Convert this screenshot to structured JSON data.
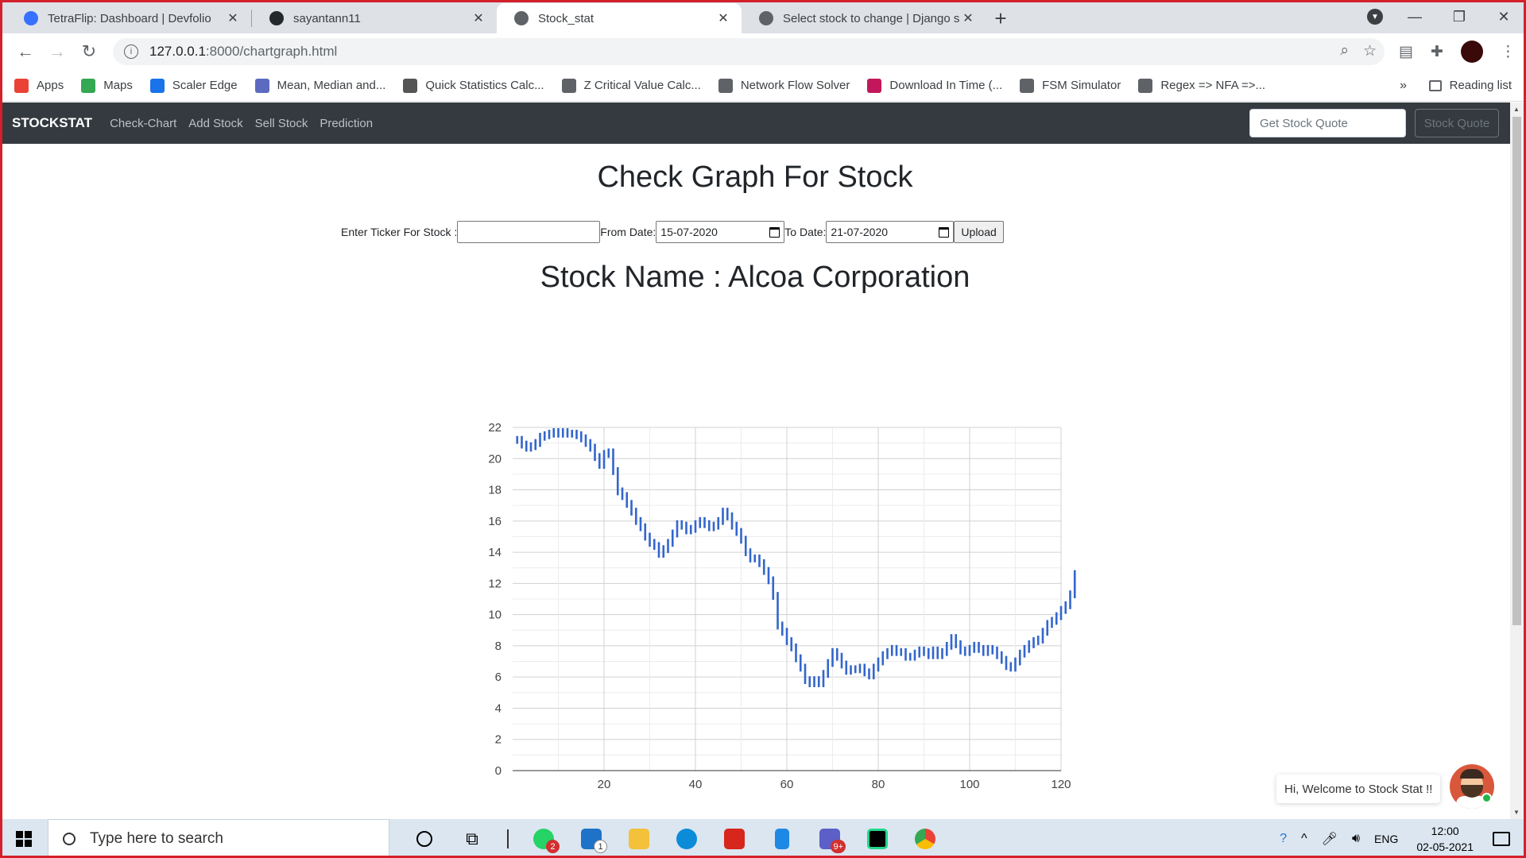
{
  "browser": {
    "tabs": [
      {
        "title": "TetraFlip: Dashboard | Devfolio",
        "favicon_color": "#3770ff",
        "active": false
      },
      {
        "title": "sayantann11",
        "favicon_color": "#24292e",
        "active": false
      },
      {
        "title": "Stock_stat",
        "favicon_color": "#5f6368",
        "active": true
      },
      {
        "title": "Select stock to change | Django s",
        "favicon_color": "#5f6368",
        "active": false
      }
    ],
    "url_host": "127.0.0.1",
    "url_rest": ":8000/chartgraph.html",
    "bookmarks": [
      {
        "label": "Apps",
        "color": "#ea4335"
      },
      {
        "label": "Maps",
        "color": "#34a853"
      },
      {
        "label": "Scaler Edge",
        "color": "#1a73e8"
      },
      {
        "label": "Mean, Median and...",
        "color": "#5c6bc0"
      },
      {
        "label": "Quick Statistics Calc...",
        "color": "#555555"
      },
      {
        "label": "Z Critical Value Calc...",
        "color": "#5f6368"
      },
      {
        "label": "Network Flow Solver",
        "color": "#5f6368"
      },
      {
        "label": "Download In Time (...",
        "color": "#c2185b"
      },
      {
        "label": "FSM Simulator",
        "color": "#5f6368"
      },
      {
        "label": "Regex => NFA =>...",
        "color": "#5f6368"
      }
    ],
    "bookmarks_more": "»",
    "reading_list": "Reading list"
  },
  "app": {
    "brand": "STOCKSTAT",
    "nav": [
      "Check-Chart",
      "Add Stock",
      "Sell Stock",
      "Prediction"
    ],
    "quote_placeholder": "Get Stock Quote",
    "quote_button": "Stock Quote",
    "title": "Check Graph For Stock",
    "form": {
      "ticker_label": "Enter Ticker For Stock :",
      "ticker_value": "",
      "from_label": "From Date:",
      "from_value": "15-07-2020",
      "to_label": "To Date:",
      "to_value": "21-07-2020",
      "upload": "Upload"
    },
    "stock_name": "Stock Name : Alcoa Corporation",
    "chat_text": "Hi, Welcome to Stock Stat !!"
  },
  "chart_data": {
    "type": "candlestick",
    "xlim": [
      0,
      120
    ],
    "ylim": [
      0,
      22
    ],
    "x_ticks": [
      20,
      40,
      60,
      80,
      100,
      120
    ],
    "y_ticks": [
      0,
      2,
      4,
      6,
      8,
      10,
      12,
      14,
      16,
      18,
      20,
      22
    ],
    "grid": true,
    "color": "#3366cc",
    "series": [
      {
        "values": [
          21.2,
          20.9,
          20.7,
          20.8,
          21.0,
          21.4,
          21.5,
          21.6,
          21.7,
          21.6,
          21.7,
          21.6,
          21.6,
          21.5,
          21.3,
          21.0,
          20.7,
          20.1,
          19.6,
          20.3,
          20.4,
          19.2,
          17.9,
          17.6,
          17.1,
          16.6,
          16.0,
          15.6,
          15.0,
          14.6,
          14.4,
          13.9,
          14.2,
          14.6,
          15.2,
          15.8,
          15.7,
          15.4,
          15.5,
          15.8,
          16.0,
          15.8,
          15.6,
          15.7,
          16.0,
          16.6,
          16.3,
          15.7,
          15.3,
          14.8,
          14.0,
          13.6,
          13.6,
          13.3,
          12.8,
          12.2,
          11.2,
          9.3,
          8.9,
          8.3,
          7.9,
          7.2,
          6.6,
          5.8,
          5.6,
          5.8,
          5.6,
          6.2,
          6.9,
          7.6,
          7.3,
          6.8,
          6.4,
          6.5,
          6.5,
          6.6,
          6.3,
          6.1,
          6.6,
          7.0,
          7.4,
          7.6,
          7.8,
          7.6,
          7.6,
          7.3,
          7.3,
          7.5,
          7.7,
          7.6,
          7.4,
          7.7,
          7.4,
          7.6,
          8.0,
          8.5,
          8.1,
          7.7,
          7.6,
          7.8,
          8.0,
          7.8,
          7.6,
          7.8,
          7.7,
          7.4,
          7.1,
          6.7,
          6.6,
          7.0,
          7.5,
          7.8,
          8.1,
          8.3,
          8.4,
          8.9,
          9.4,
          9.6,
          9.9,
          10.3,
          10.6,
          11.3,
          12.6
        ]
      }
    ]
  },
  "taskbar": {
    "search_placeholder": "Type here to search",
    "lang": "ENG",
    "time": "12:00",
    "date": "02-05-2021",
    "whatsapp_badge": "2",
    "mail_badge": "1",
    "teams_badge": "9+"
  }
}
